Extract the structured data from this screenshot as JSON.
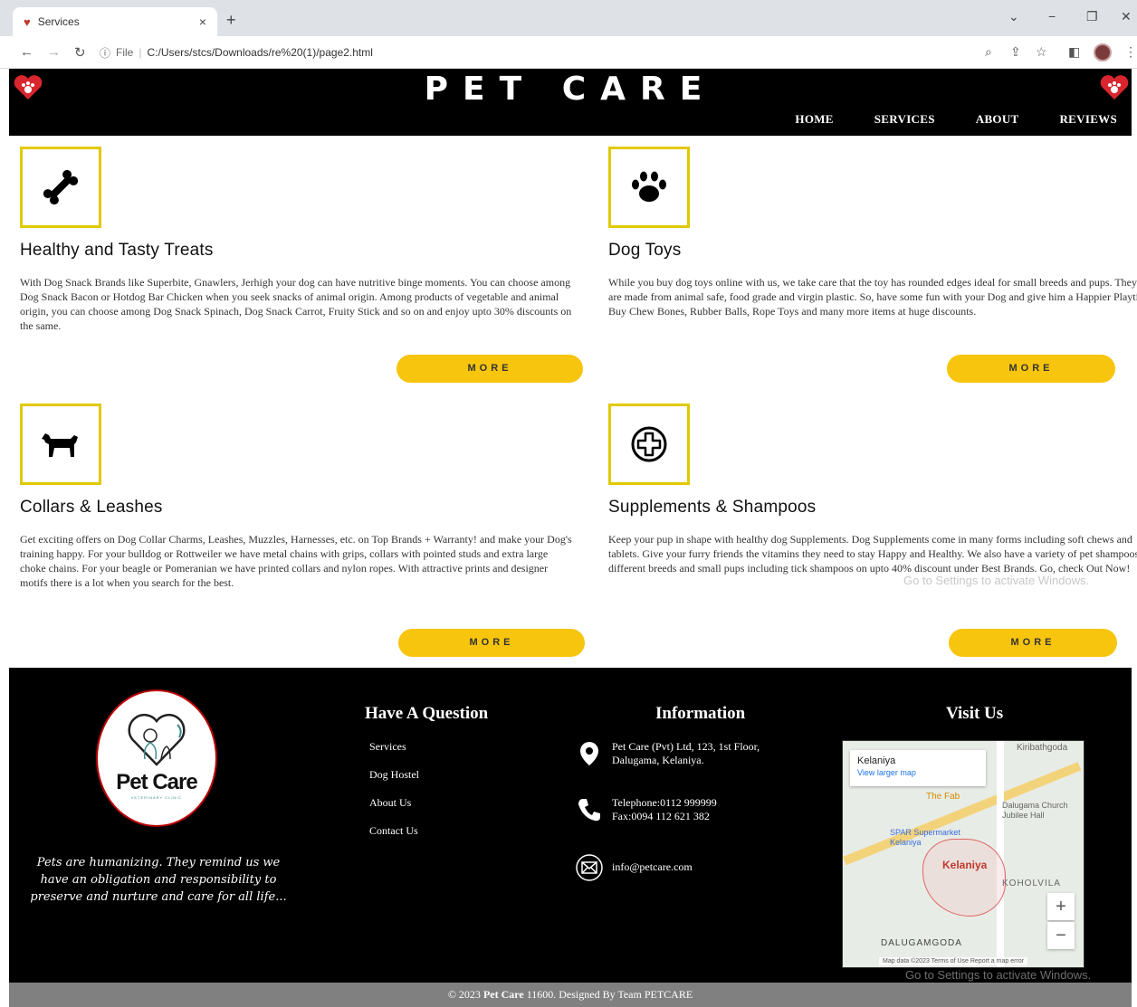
{
  "browser": {
    "tab_title": "Services",
    "url_scheme": "File",
    "url": "C:/Users/stcs/Downloads/re%20(1)/page2.html",
    "tab_close": "×",
    "new_tab": "+"
  },
  "header": {
    "title": "PET CARE",
    "nav": [
      "HOME",
      "SERVICES",
      "ABOUT",
      "REVIEWS"
    ]
  },
  "services": [
    {
      "icon": "bone-icon",
      "title": "Healthy and Tasty Treats",
      "text": "With Dog Snack Brands like Superbite, Gnawlers, Jerhigh your dog can have nutritive binge moments. You can choose among Dog Snack Bacon or Hotdog Bar Chicken when you seek snacks of animal origin. Among products of vegetable and animal origin, you can choose among Dog Snack Spinach, Dog Snack Carrot, Fruity Stick and so on and enjoy upto 30% discounts on the same.",
      "button": "MORE"
    },
    {
      "icon": "paw-icon",
      "title": "Dog Toys",
      "text": "While you buy dog toys online with us, we take care that the toy has rounded edges ideal for small breeds and pups. They all are made from animal safe, food grade and virgin plastic. So, have some fun with your Dog and give him a Happier Playtime. Buy Chew Bones, Rubber Balls, Rope Toys and many more items at huge discounts.",
      "button": "MORE"
    },
    {
      "icon": "dog-icon",
      "title": "Collars & Leashes",
      "text": "Get exciting offers on Dog Collar Charms, Leashes, Muzzles, Harnesses, etc. on Top Brands + Warranty! and make your Dog's training happy. For your bulldog or Rottweiler we have metal chains with grips, collars with pointed studs and extra large choke chains. For your beagle or Pomeranian we have printed collars and nylon ropes. With attractive prints and designer motifs there is a lot when you search for the best.",
      "button": "MORE"
    },
    {
      "icon": "medical-cross-icon",
      "title": "Supplements & Shampoos",
      "text": "Keep your pup in shape with healthy dog Supplements. Dog Supplements come in many forms including soft chews and tablets. Give your furry friends the vitamins they need to stay Happy and Healthy. We also have a variety of pet shampoos for different breeds and small pups including tick shampoos on upto 40% discount under Best Brands. Go, check Out Now!",
      "button": "MORE"
    }
  ],
  "watermark": "Go to Settings to activate Windows.",
  "footer": {
    "logo_text": "Pet Care",
    "logo_subtext": "VETERINARY CLINIC",
    "quote": "Pets are humanizing. They remind us we have an obligation and responsibility to preserve and nurture and care for all life...",
    "question_heading": "Have A Question",
    "links": [
      "Services",
      "Dog Hostel",
      "About Us",
      "Contact Us"
    ],
    "info_heading": "Information",
    "address": "Pet Care (Pvt) Ltd, 123, 1st Floor, Dalugama, Kelaniya.",
    "telephone": "Telephone:0112 999999",
    "fax": "Fax:0094 112 621 382",
    "email": "info@petcare.com",
    "visit_heading": "Visit Us",
    "map": {
      "place": "Kelaniya",
      "view_larger": "View larger map",
      "labels": [
        "Kiribathgoda",
        "The Fab",
        "Dalugama Church Jubilee Hall",
        "SPAR Supermarket Kelaniya",
        "Kelaniya",
        "KOHOLVILA",
        "DALUGAMGODA"
      ],
      "zoom_in": "+",
      "zoom_out": "−",
      "attribution": "Map data ©2023  Terms of Use  Report a map error"
    },
    "copyright_prefix": "© 2023 ",
    "copyright_brand": "Pet Care",
    "copyright_suffix": " 11600. Designed By Team PETCARE"
  }
}
